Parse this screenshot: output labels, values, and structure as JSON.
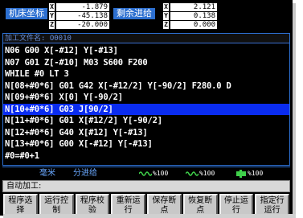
{
  "coords": {
    "machine_label": "机床坐标",
    "remaining_label": "剩余进给",
    "machine": [
      {
        "axis": "X",
        "value": "-1.879"
      },
      {
        "axis": "Y",
        "value": "-45.138"
      },
      {
        "axis": "Z",
        "value": "-20.000"
      }
    ],
    "remaining": [
      {
        "axis": "X",
        "value": "2.121"
      },
      {
        "axis": "Y",
        "value": "0.138"
      },
      {
        "axis": "Z",
        "value": "0.000"
      }
    ]
  },
  "program": {
    "file_label": "加工文件名: O0010",
    "lines": [
      "N06 G00 X[-#12] Y[-#13]",
      "N07 G01 Z[-#10] M03 S600 F200",
      "WHILE #0 LT 3",
      "N[08+#0*6] G01 G42 X[-#12/2] Y[-90/2] F280.0 D",
      "N[09+#0*6] X[0] Y[-90/2]",
      "N[10+#0*6] G03 J[90/2]",
      "N[11+#0*6] G01 X[#12/2] Y[-90/2]",
      "N[12+#0*6] G40 X[#12] Y[-#13]",
      "N[13+#0*6] G00 X[-#12] Y[-#13]",
      "#0=#0+1"
    ],
    "selected_index": 5
  },
  "status": {
    "unit": "毫米",
    "feed_mode": "分进给",
    "feed_override": "%100",
    "spindle_override": "%100",
    "rapid_override": "%100"
  },
  "mode": {
    "label": "自动加工:"
  },
  "softkeys": [
    "程序选择",
    "运行控制",
    "程序校验",
    "重新运行",
    "保存断点",
    "恢复断点",
    "停止运行",
    "指定行运行"
  ],
  "colors": {
    "background": "#000000",
    "label_blue": "#2c6fd0",
    "highlight": "#0a2cf0",
    "status_text": "#6aa8ff",
    "softkey_face": "#c8c8c8"
  }
}
